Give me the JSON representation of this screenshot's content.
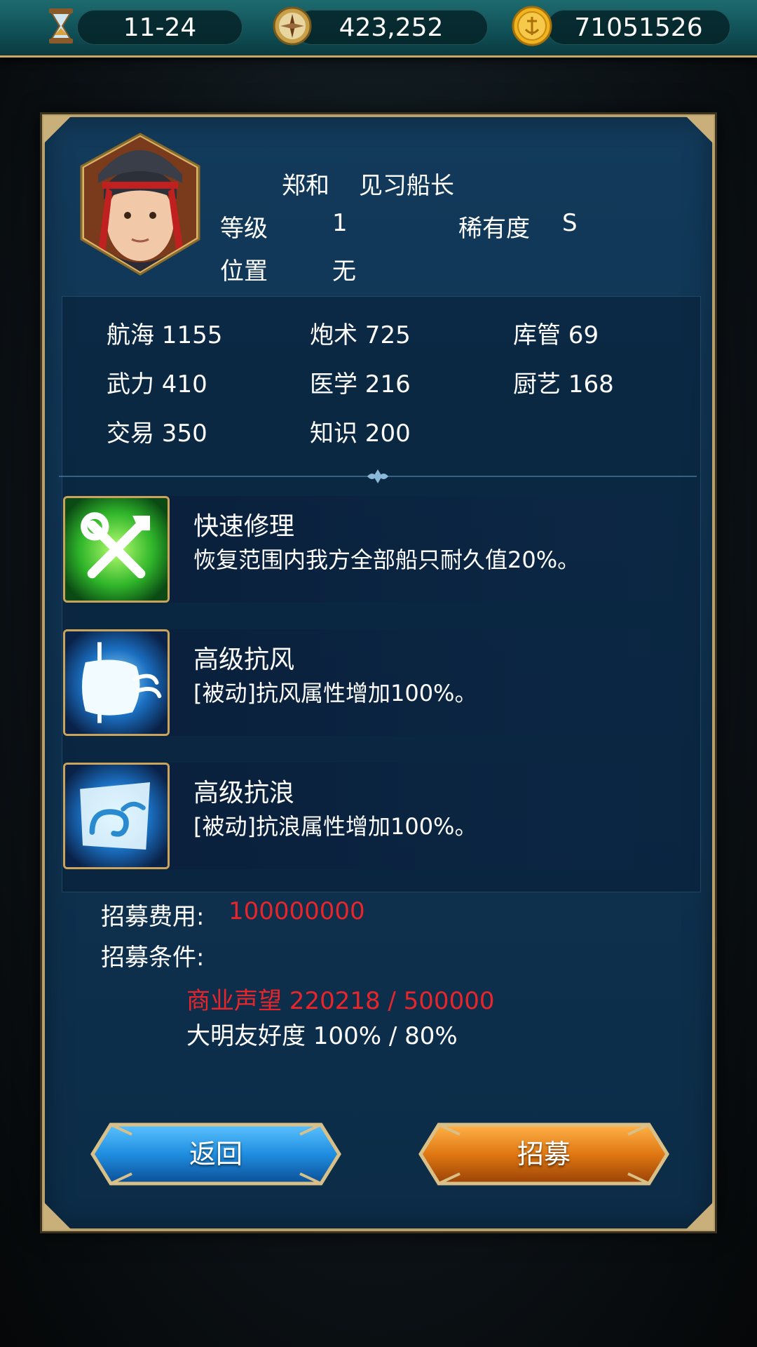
{
  "resources": {
    "date": "11-24",
    "compass_value": "423,252",
    "gold": "71051526"
  },
  "officer": {
    "name": "郑和",
    "title": "见习船长",
    "level_label": "等级",
    "level": "1",
    "rarity_label": "稀有度",
    "rarity": "S",
    "position_label": "位置",
    "position": "无"
  },
  "stats": [
    {
      "label": "航海 1155"
    },
    {
      "label": "炮术 725"
    },
    {
      "label": "库管 69"
    },
    {
      "label": "武力 410"
    },
    {
      "label": "医学 216"
    },
    {
      "label": "厨艺 168"
    },
    {
      "label": "交易 350"
    },
    {
      "label": "知识 200"
    }
  ],
  "skills": [
    {
      "name": "快速修理",
      "desc": "恢复范围内我方全部船只耐久值20%。",
      "icon": "repair-tools-icon"
    },
    {
      "name": "高级抗风",
      "desc": "[被动]抗风属性增加100%。",
      "icon": "wind-sail-icon"
    },
    {
      "name": "高级抗浪",
      "desc": "[被动]抗浪属性增加100%。",
      "icon": "wave-icon"
    }
  ],
  "recruit": {
    "cost_label": "招募费用:",
    "cost_value": "100000000",
    "cond_label": "招募条件:",
    "cond1": "商业声望 220218 / 500000",
    "cond2": "大明友好度 100% / 80%"
  },
  "buttons": {
    "back": "返回",
    "recruit": "招募"
  },
  "colors": {
    "panel": "#0f3352",
    "border_gold": "#b9a06a",
    "unmet_red": "#e8252a",
    "btn_blue": "#1f8ee0",
    "btn_orange": "#e07812"
  }
}
